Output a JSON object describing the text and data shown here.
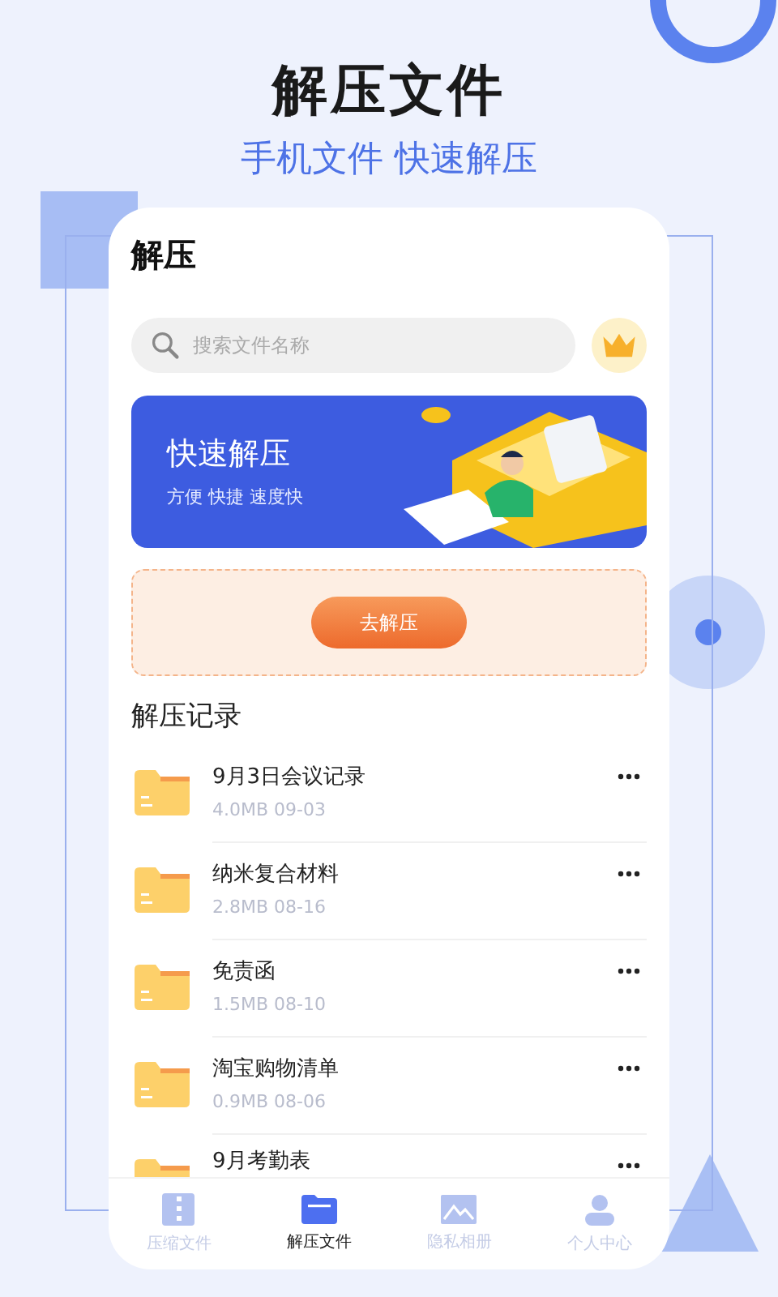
{
  "headline": "解压文件",
  "subtitle": "手机文件 快速解压",
  "screen": {
    "title": "解压",
    "search": {
      "placeholder": "搜索文件名称"
    },
    "banner": {
      "title": "快速解压",
      "tagline": "方便 快捷 速度快"
    },
    "action_button": "去解压",
    "section_title": "解压记录",
    "records": [
      {
        "name": "9月3日会议记录",
        "meta": "4.0MB 09-03"
      },
      {
        "name": "纳米复合材料",
        "meta": "2.8MB 08-16"
      },
      {
        "name": "免责函",
        "meta": "1.5MB 08-10"
      },
      {
        "name": "淘宝购物清单",
        "meta": "0.9MB 08-06"
      },
      {
        "name": "9月考勤表"
      }
    ],
    "tabs": [
      {
        "label": "压缩文件",
        "kind": "zip",
        "selected": false
      },
      {
        "label": "解压文件",
        "kind": "folder",
        "selected": true
      },
      {
        "label": "隐私相册",
        "kind": "image",
        "selected": false
      },
      {
        "label": "个人中心",
        "kind": "person",
        "selected": false
      }
    ]
  }
}
